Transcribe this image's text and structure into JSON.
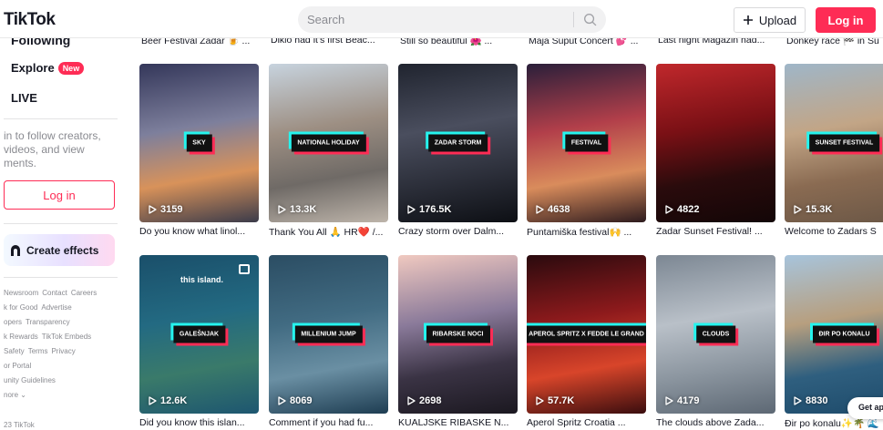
{
  "header": {
    "logo": "TikTok",
    "search_placeholder": "Search",
    "upload_label": "Upload",
    "login_label": "Log in"
  },
  "sidebar": {
    "following": "Following",
    "explore": "Explore",
    "explore_badge": "New",
    "live": "LIVE",
    "login_hint": "in to follow creators, videos, and view ments.",
    "login_label": "Log in",
    "effects_label": "Create effects",
    "footer_rows": [
      [
        "Newsroom",
        "Contact",
        "Careers"
      ],
      [
        "k for Good",
        "Advertise"
      ],
      [
        "opers",
        "Transparency"
      ],
      [
        "k Rewards",
        "TikTok Embeds"
      ],
      [
        "Safety",
        "Terms",
        "Privacy"
      ],
      [
        "or Portal"
      ],
      [
        "unity Guidelines"
      ],
      [
        "nore ⌄"
      ]
    ],
    "copyright": "23 TikTok"
  },
  "top_captions": [
    "Beer Festival Zadar 🍺 ...",
    "Diklo had it's first Beac...",
    "Still so beautiful 🌺 ...",
    "Maja Šuput Concert 💕 ...",
    "Last night Magazin had...",
    "Donkey race 🏁 in Su"
  ],
  "videos": [
    {
      "tag": "SKY",
      "views": "3159",
      "caption": "Do you know what linol...",
      "colors": [
        "#34375a",
        "#7d7f9c",
        "#d8925a",
        "#3b3b4a"
      ]
    },
    {
      "tag": "NATIONAL HOLIDAY",
      "views": "13.3K",
      "caption": "Thank You All 🙏 HR❤️ /...",
      "colors": [
        "#c7d3de",
        "#9d8f83",
        "#6f6a66",
        "#bdb4aa"
      ]
    },
    {
      "tag": "ZADAR STORM",
      "views": "176.5K",
      "caption": "Crazy storm over Dalm...",
      "colors": [
        "#20242f",
        "#4a4e5e",
        "#2c2f3a",
        "#0d0f14"
      ]
    },
    {
      "tag": "FESTIVAL",
      "views": "4638",
      "caption": "Puntamiška festival🙌 ...",
      "colors": [
        "#2a1f3a",
        "#b23f4a",
        "#d98c5c",
        "#2d1b1e"
      ]
    },
    {
      "tag": "",
      "views": "4822",
      "caption": "Zadar Sunset Festival! ...",
      "colors": [
        "#c0282c",
        "#7a1015",
        "#2a0b0c",
        "#130607"
      ]
    },
    {
      "tag": "SUNSET FESTIVAL",
      "views": "15.3K",
      "caption": "Welcome to Zadars S",
      "colors": [
        "#9fb6c8",
        "#c2a586",
        "#8a6b52",
        "#6b5746"
      ]
    },
    {
      "tag": "GALEŠNJAK",
      "views": "12.6K",
      "caption": "Did you know this islan...",
      "overtext": "this island.",
      "colors": [
        "#1a4f6a",
        "#236a82",
        "#3a7a6a",
        "#1d5670"
      ]
    },
    {
      "tag": "MILLENIUM JUMP",
      "views": "8069",
      "caption": "Comment if you had fu...",
      "colors": [
        "#2b4d63",
        "#416b82",
        "#6a8fa3",
        "#1e3d52"
      ]
    },
    {
      "tag": "RIBARSKE NOCI",
      "views": "2698",
      "caption": "KUALJSKE RIBASKE N...",
      "colors": [
        "#f0c9c0",
        "#8a7a9a",
        "#3a3344",
        "#1b1820"
      ]
    },
    {
      "tag": "APEROL SPRITZ X FEDDE LE GRAND",
      "views": "57.7K",
      "caption": "Aperol Spritz Croatia ...",
      "colors": [
        "#2a0a0e",
        "#8e1a1c",
        "#d8452a",
        "#3a0d0e"
      ]
    },
    {
      "tag": "CLOUDS",
      "views": "4179",
      "caption": "The clouds above Zada...",
      "colors": [
        "#7c8793",
        "#b9c0c8",
        "#8c96a0",
        "#5d6874"
      ]
    },
    {
      "tag": "ĐIR PO KONALU",
      "views": "8830",
      "caption": "Đir po konalu✨🌴 🌊",
      "colors": [
        "#a7c4dc",
        "#b79f7f",
        "#2f5f7f",
        "#1d4a6a"
      ]
    }
  ],
  "get_app": "Get ap"
}
